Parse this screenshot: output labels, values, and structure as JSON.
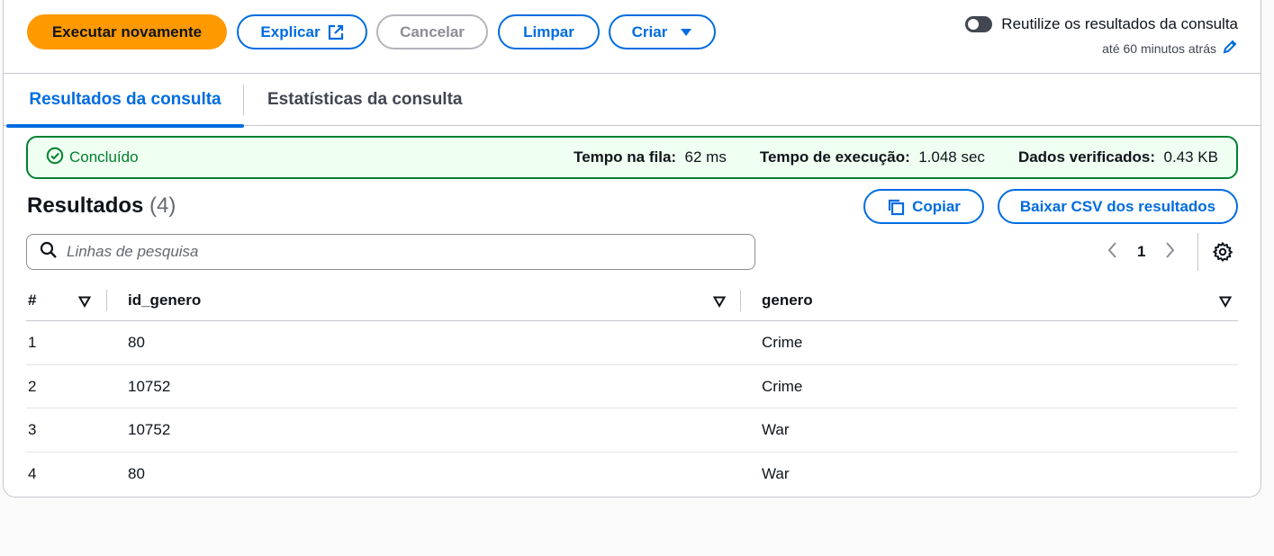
{
  "toolbar": {
    "run_again": "Executar novamente",
    "explain": "Explicar",
    "cancel": "Cancelar",
    "clear": "Limpar",
    "create": "Criar"
  },
  "reuse": {
    "label": "Reutilize os resultados da consulta",
    "sublabel": "até 60 minutos atrás",
    "enabled": false
  },
  "tabs": [
    {
      "label": "Resultados da consulta",
      "active": true
    },
    {
      "label": "Estatísticas da consulta",
      "active": false
    }
  ],
  "status": {
    "state": "Concluído",
    "queue_label": "Tempo na fila:",
    "queue_value": "62 ms",
    "exec_label": "Tempo de execução:",
    "exec_value": "1.048 sec",
    "data_label": "Dados verificados:",
    "data_value": "0.43 KB"
  },
  "results": {
    "title": "Resultados",
    "count": "(4)",
    "copy": "Copiar",
    "download": "Baixar CSV dos resultados"
  },
  "search": {
    "placeholder": "Linhas de pesquisa"
  },
  "pagination": {
    "current_page": "1"
  },
  "table": {
    "columns": [
      "#",
      "id_genero",
      "genero"
    ],
    "rows": [
      [
        "1",
        "80",
        "Crime"
      ],
      [
        "2",
        "10752",
        "Crime"
      ],
      [
        "3",
        "10752",
        "War"
      ],
      [
        "4",
        "80",
        "War"
      ]
    ]
  },
  "colors": {
    "primary": "#ff9900",
    "link": "#006ce0",
    "success": "#00802f",
    "success_bg": "#effff1"
  },
  "icons": [
    "external-link-icon",
    "caret-down-icon",
    "pencil-icon",
    "check-circle-icon",
    "copy-icon",
    "search-icon",
    "chevron-left-icon",
    "chevron-right-icon",
    "gear-icon",
    "sort-icon"
  ]
}
